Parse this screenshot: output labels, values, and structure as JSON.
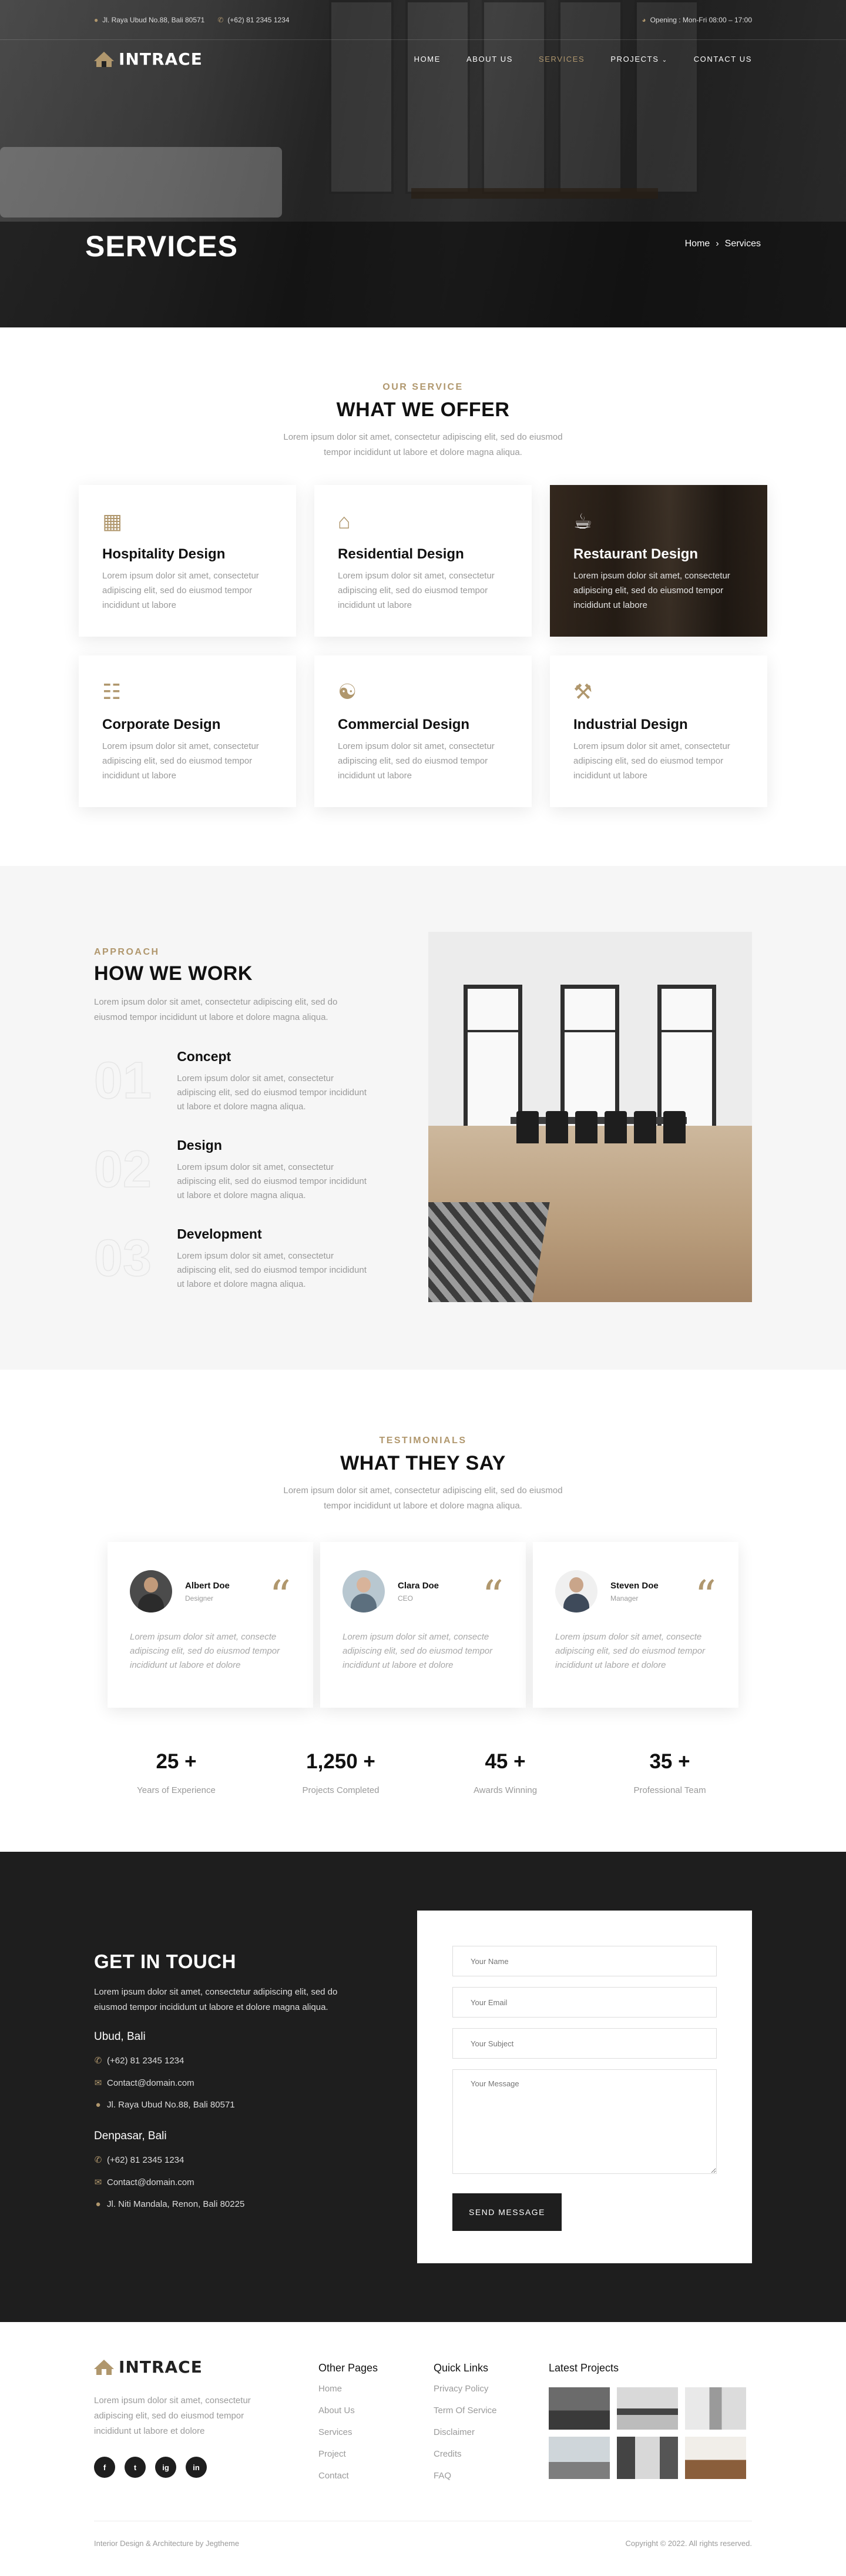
{
  "topbar": {
    "address": "Jl. Raya Ubud No.88, Bali 80571",
    "phone": "(+62) 81 2345 1234",
    "hours": "Opening : Mon-Fri 08:00 – 17:00"
  },
  "brand": {
    "name": "INTRACE"
  },
  "nav": {
    "items": [
      {
        "label": "HOME"
      },
      {
        "label": "ABOUT US"
      },
      {
        "label": "SERVICES"
      },
      {
        "label": "PROJECTS"
      },
      {
        "label": "CONTACT US"
      }
    ]
  },
  "hero": {
    "title": "SERVICES",
    "breadcrumb_home": "Home",
    "breadcrumb_current": "Services"
  },
  "services": {
    "eyebrow": "OUR SERVICE",
    "title": "WHAT WE OFFER",
    "description": "Lorem ipsum dolor sit amet, consectetur adipiscing elit, sed do eiusmod tempor incididunt ut labore et dolore magna aliqua.",
    "items": [
      {
        "title": "Hospitality Design",
        "text": "Lorem ipsum dolor sit amet, consectetur adipiscing elit, sed do eiusmod tempor incididunt ut labore",
        "icon": "building-icon"
      },
      {
        "title": "Residential Design",
        "text": "Lorem ipsum dolor sit amet, consectetur adipiscing elit, sed do eiusmod tempor incididunt ut labore",
        "icon": "house-icon"
      },
      {
        "title": "Restaurant Design",
        "text": "Lorem ipsum dolor sit amet, consectetur adipiscing elit, sed do eiusmod tempor incididunt ut labore",
        "icon": "restaurant-icon"
      },
      {
        "title": "Corporate Design",
        "text": "Lorem ipsum dolor sit amet, consectetur adipiscing elit, sed do eiusmod tempor incididunt ut labore",
        "icon": "blueprint-icon"
      },
      {
        "title": "Commercial Design",
        "text": "Lorem ipsum dolor sit amet, consectetur adipiscing elit, sed do eiusmod tempor incididunt ut labore",
        "icon": "coin-hand-icon"
      },
      {
        "title": "Industrial Design",
        "text": "Lorem ipsum dolor sit amet, consectetur adipiscing elit, sed do eiusmod tempor incididunt ut labore",
        "icon": "tools-icon"
      }
    ]
  },
  "approach": {
    "eyebrow": "APPROACH",
    "title": "HOW WE WORK",
    "description": "Lorem ipsum dolor sit amet, consectetur adipiscing elit, sed do eiusmod tempor incididunt ut labore et dolore magna aliqua.",
    "steps": [
      {
        "num": "01",
        "title": "Concept",
        "text": "Lorem ipsum dolor sit amet, consectetur adipiscing elit, sed do eiusmod tempor incididunt ut labore et dolore magna aliqua."
      },
      {
        "num": "02",
        "title": "Design",
        "text": "Lorem ipsum dolor sit amet, consectetur adipiscing elit, sed do eiusmod tempor incididunt ut labore et dolore magna aliqua."
      },
      {
        "num": "03",
        "title": "Development",
        "text": "Lorem ipsum dolor sit amet, consectetur adipiscing elit, sed do eiusmod tempor incididunt ut labore et dolore magna aliqua."
      }
    ]
  },
  "testimonials": {
    "eyebrow": "TESTIMONIALS",
    "title": "WHAT THEY SAY",
    "description": "Lorem ipsum dolor sit amet, consectetur adipiscing elit, sed do eiusmod tempor incididunt ut labore et dolore magna aliqua.",
    "items": [
      {
        "name": "Albert Doe",
        "role": "Designer",
        "text": "Lorem ipsum dolor sit amet, consecte adipiscing elit, sed do eiusmod tempor incididunt ut labore et dolore"
      },
      {
        "name": "Clara Doe",
        "role": "CEO",
        "text": "Lorem ipsum dolor sit amet, consecte adipiscing elit, sed do eiusmod tempor incididunt ut labore et dolore"
      },
      {
        "name": "Steven Doe",
        "role": "Manager",
        "text": "Lorem ipsum dolor sit amet, consecte adipiscing elit, sed do eiusmod tempor incididunt ut labore et dolore"
      }
    ],
    "quote_mark": "“"
  },
  "stats": [
    {
      "value": "25 +",
      "label": "Years of Experience"
    },
    {
      "value": "1,250 +",
      "label": "Projects Completed"
    },
    {
      "value": "45 +",
      "label": "Awards Winning"
    },
    {
      "value": "35 +",
      "label": "Professional Team"
    }
  ],
  "contact": {
    "title": "GET IN TOUCH",
    "description": "Lorem ipsum dolor sit amet, consectetur adipiscing elit, sed do eiusmod tempor incididunt ut labore et dolore magna aliqua.",
    "offices": [
      {
        "city": "Ubud, Bali",
        "phone": "(+62) 81 2345 1234",
        "email": "Contact@domain.com",
        "address": "Jl. Raya Ubud No.88, Bali 80571"
      },
      {
        "city": "Denpasar, Bali",
        "phone": "(+62) 81 2345 1234",
        "email": "Contact@domain.com",
        "address": "Jl. Niti Mandala, Renon, Bali 80225"
      }
    ],
    "form": {
      "name_placeholder": "Your Name",
      "email_placeholder": "Your Email",
      "subject_placeholder": "Your Subject",
      "message_placeholder": "Your Message",
      "submit_label": "SEND MESSAGE"
    }
  },
  "footer": {
    "about": "Lorem ipsum dolor sit amet, consectetur adipiscing elit, sed do eiusmod tempor incididunt ut labore et dolore",
    "socials": [
      "f",
      "t",
      "ig",
      "in"
    ],
    "other_pages_title": "Other Pages",
    "other_pages": [
      "Home",
      "About Us",
      "Services",
      "Project",
      "Contact"
    ],
    "quick_links_title": "Quick Links",
    "quick_links": [
      "Privacy Policy",
      "Term Of Service",
      "Disclaimer",
      "Credits",
      "FAQ"
    ],
    "latest_projects_title": "Latest Projects",
    "credit": "Interior Design & Architecture by Jegtheme",
    "copyright": "Copyright © 2022. All rights reserved."
  },
  "colors": {
    "accent": "#b0976d",
    "dark": "#1e1e1e",
    "muted": "#9a9a9a"
  }
}
